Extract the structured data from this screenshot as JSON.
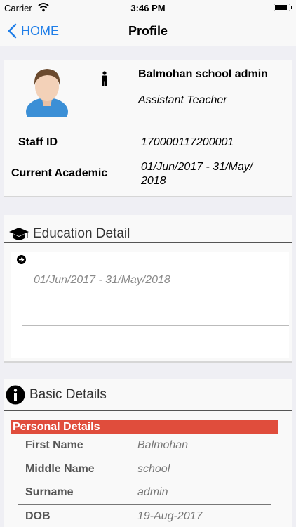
{
  "status_bar": {
    "carrier": "Carrier",
    "time": "3:46 PM"
  },
  "nav": {
    "back_label": "HOME",
    "title": "Profile"
  },
  "profile": {
    "name": "Balmohan school admin",
    "role": "Assistant Teacher",
    "staff_id_label": "Staff ID",
    "staff_id_value": "170000117200001",
    "academic_label": "Current Academic",
    "academic_value": "01/Jun/2017 - 31/May/ 2018"
  },
  "education": {
    "title": "Education Detail",
    "items": [
      {
        "date_range": "01/Jun/2017 - 31/May/2018"
      }
    ]
  },
  "basic": {
    "title": "Basic Details",
    "personal_header": "Personal Details",
    "fields": [
      {
        "label": "First Name",
        "value": "Balmohan"
      },
      {
        "label": "Middle Name",
        "value": "school"
      },
      {
        "label": "Surname",
        "value": "admin"
      },
      {
        "label": "DOB",
        "value": "19-Aug-2017"
      }
    ]
  },
  "colors": {
    "accent": "#1f7ee8",
    "section_bar": "#e04d3c"
  }
}
